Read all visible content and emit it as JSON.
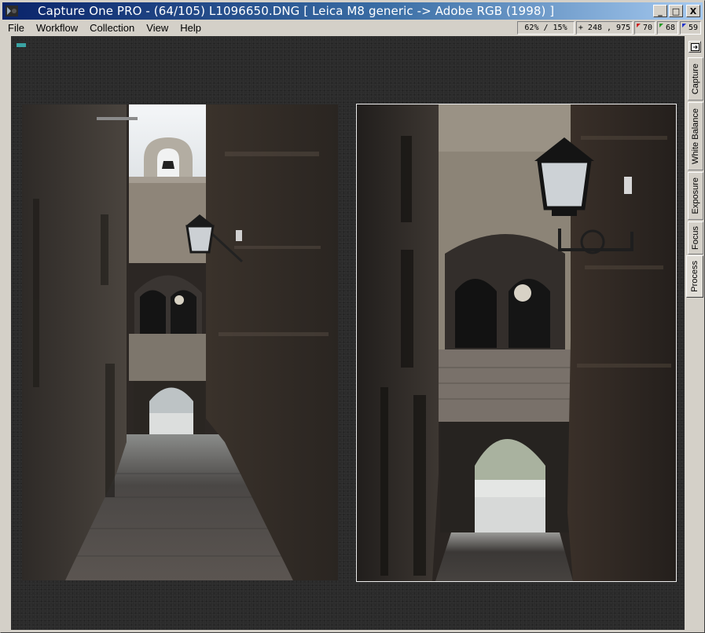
{
  "window": {
    "title": "Capture One PRO  -  (64/105) L1096650.DNG  [ Leica M8 generic -> Adobe RGB (1998) ]",
    "buttons": {
      "minimize": "_",
      "maximize": "□",
      "close": "X"
    }
  },
  "menu": [
    "File",
    "Workflow",
    "Collection",
    "View",
    "Help"
  ],
  "status": {
    "zoom": "62% / 15%",
    "cursor_symbol": "+",
    "coordinates": "248 , 975",
    "rgb": [
      {
        "value": "70",
        "color": "#cc2222"
      },
      {
        "value": "68",
        "color": "#229922"
      },
      {
        "value": "59",
        "color": "#2233cc"
      }
    ]
  },
  "side_tabs": [
    "Capture",
    "White Balance",
    "Exposure",
    "Focus",
    "Process"
  ],
  "active_tab": "Process",
  "icons": {
    "app": "capture-one-app-icon",
    "panel_toggle": "panel-toggle-icon",
    "viewer_marker": "viewer-marker-icon"
  },
  "photos": {
    "left": "dark-alley-photo-full",
    "right": "dark-alley-photo-zoomed"
  }
}
